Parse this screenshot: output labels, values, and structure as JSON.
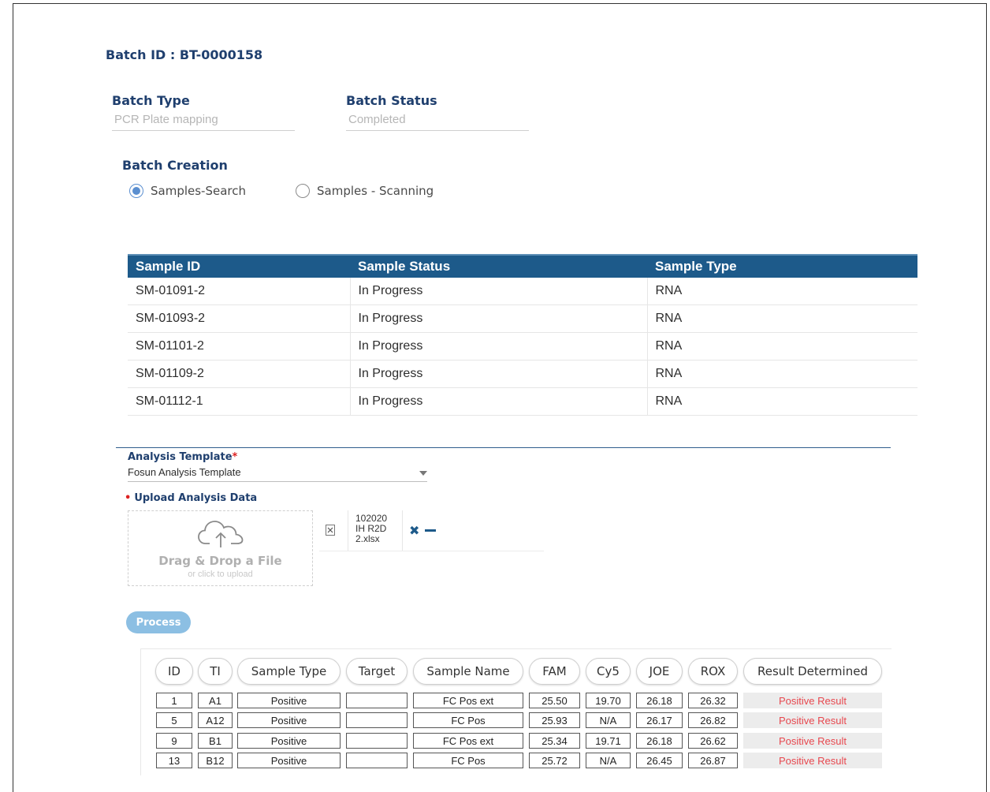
{
  "batch": {
    "id_label": "Batch ID : BT-0000158",
    "type_label": "Batch Type",
    "type_value": "PCR Plate mapping",
    "status_label": "Batch Status",
    "status_value": "Completed"
  },
  "creation": {
    "title": "Batch Creation",
    "options": [
      {
        "label": "Samples-Search",
        "selected": true
      },
      {
        "label": "Samples - Scanning",
        "selected": false
      }
    ]
  },
  "samples_table": {
    "headers": [
      "Sample ID",
      "Sample Status",
      "Sample Type"
    ],
    "rows": [
      [
        "SM-01091-2",
        "In Progress",
        "RNA"
      ],
      [
        "SM-01093-2",
        "In Progress",
        "RNA"
      ],
      [
        "SM-01101-2",
        "In Progress",
        "RNA"
      ],
      [
        "SM-01109-2",
        "In Progress",
        "RNA"
      ],
      [
        "SM-01112-1",
        "In Progress",
        "RNA"
      ]
    ]
  },
  "analysis": {
    "template_label": "Analysis Template",
    "required_mark": "*",
    "template_value": "Fosun Analysis Template",
    "upload_label": "Upload Analysis Data",
    "upload_mark": "•",
    "drop_title": "Drag & Drop a File",
    "drop_sub": "or click to upload",
    "file_name_lines": [
      "102020",
      "IH R2D",
      "2.xlsx"
    ],
    "remove_glyph": "✖",
    "process_label": "Process"
  },
  "results_table": {
    "headers": [
      "ID",
      "TI",
      "Sample Type",
      "Target",
      "Sample Name",
      "FAM",
      "Cy5",
      "JOE",
      "ROX",
      "Result Determined"
    ],
    "rows": [
      [
        "1",
        "A1",
        "Positive",
        "",
        "FC Pos ext",
        "25.50",
        "19.70",
        "26.18",
        "26.32",
        "Positive Result"
      ],
      [
        "5",
        "A12",
        "Positive",
        "",
        "FC Pos",
        "25.93",
        "N/A",
        "26.17",
        "26.82",
        "Positive Result"
      ],
      [
        "9",
        "B1",
        "Positive",
        "",
        "FC Pos ext",
        "25.34",
        "19.71",
        "26.18",
        "26.62",
        "Positive Result"
      ],
      [
        "13",
        "B12",
        "Positive",
        "",
        "FC Pos",
        "25.72",
        "N/A",
        "26.45",
        "26.87",
        "Positive Result"
      ]
    ]
  },
  "colors": {
    "header_blue": "#1d5a8a",
    "label_navy": "#1f3f6e",
    "result_red": "#e8484f",
    "process_button": "#8cbfe3"
  },
  "icons": [
    "upload-cloud-icon",
    "excel-file-icon",
    "remove-x-icon",
    "minus-icon",
    "chevron-down-icon"
  ]
}
